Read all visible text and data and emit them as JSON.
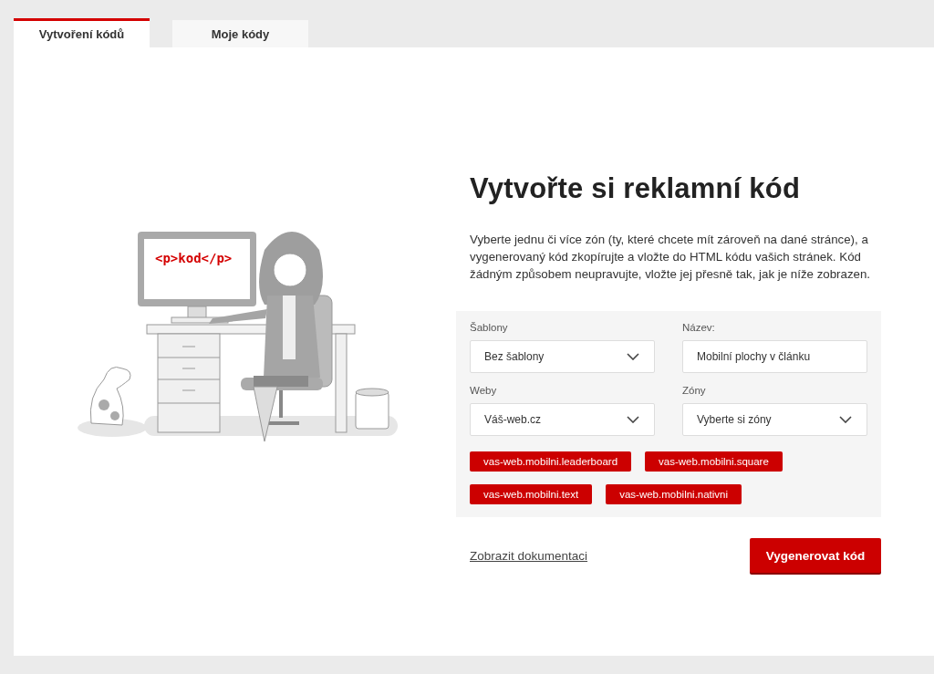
{
  "tabs": [
    {
      "label": "Vytvoření kódů",
      "selected": true
    },
    {
      "label": "Moje kódy",
      "selected": false
    }
  ],
  "illustration": {
    "screen_text": "<p>kod</p>"
  },
  "heading": "Vytvořte si reklamní kód",
  "description": "Vyberte jednu či více zón (ty, které chcete mít zároveň na dané stránce), a vygenerovaný kód zkopírujte a vložte do HTML kódu vašich stránek. Kód žádným způsobem neupravujte, vložte jej přesně tak, jak je níže zobrazen.",
  "form": {
    "fields": [
      {
        "kind": "select",
        "label": "Šablony",
        "value": "Bez šablony"
      },
      {
        "kind": "input",
        "label": "Název:",
        "value": "Mobilní plochy v článku"
      },
      {
        "kind": "select",
        "label": "Weby",
        "value": "Váš-web.cz"
      },
      {
        "kind": "select",
        "label": "Zóny",
        "placeholder": "Vyberte si zóny"
      }
    ],
    "zones": [
      "vas-web.mobilni.leaderboard",
      "vas-web.mobilni.square",
      "vas-web.mobilni.text",
      "vas-web.mobilni.nativni"
    ]
  },
  "docs_link": "Zobrazit dokumentaci",
  "generate_button": "Vygenerovat kód"
}
